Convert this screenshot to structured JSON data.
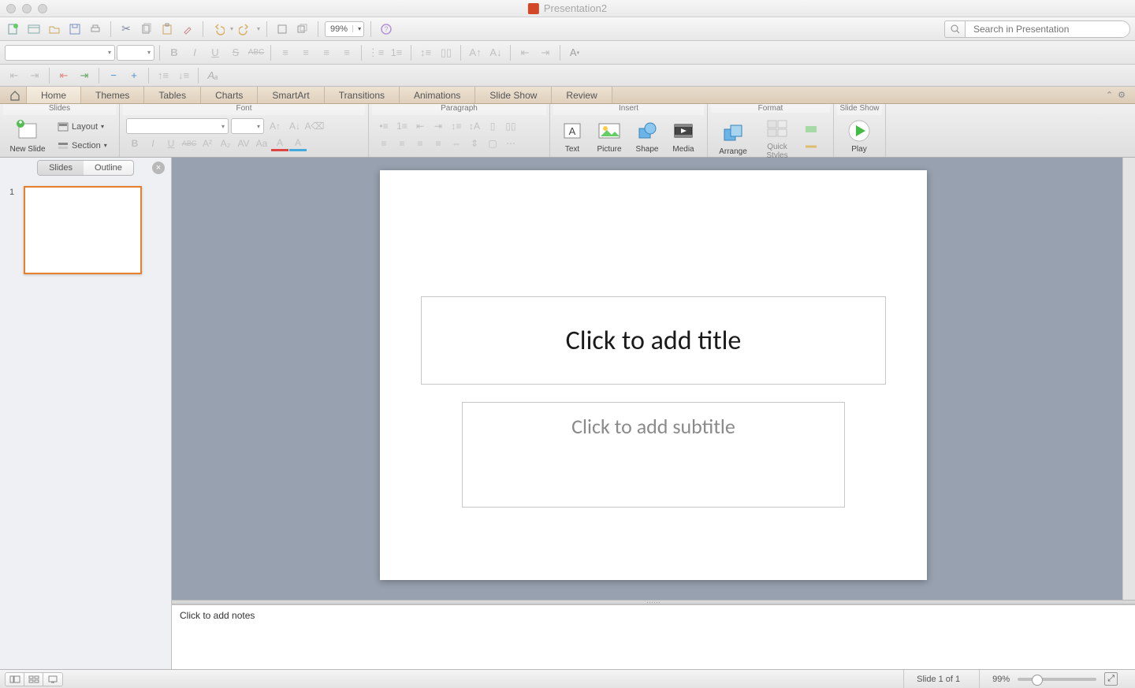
{
  "window": {
    "title": "Presentation2"
  },
  "toolbar": {
    "zoom": "99%",
    "search_placeholder": "Search in Presentation"
  },
  "tabs": {
    "items": [
      "Home",
      "Themes",
      "Tables",
      "Charts",
      "SmartArt",
      "Transitions",
      "Animations",
      "Slide Show",
      "Review"
    ],
    "active": "Home"
  },
  "ribbon": {
    "groups": {
      "slides": {
        "title": "Slides",
        "new_slide": "New Slide",
        "layout": "Layout",
        "section": "Section"
      },
      "font": {
        "title": "Font"
      },
      "paragraph": {
        "title": "Paragraph"
      },
      "insert": {
        "title": "Insert",
        "text": "Text",
        "picture": "Picture",
        "shape": "Shape",
        "media": "Media"
      },
      "format": {
        "title": "Format",
        "arrange": "Arrange",
        "quick_styles": "Quick Styles"
      },
      "slide_show": {
        "title": "Slide Show",
        "play": "Play"
      }
    }
  },
  "side_panel": {
    "tabs": {
      "slides": "Slides",
      "outline": "Outline"
    },
    "slide_number": "1"
  },
  "slide": {
    "title_placeholder": "Click to add title",
    "subtitle_placeholder": "Click to add subtitle"
  },
  "notes": {
    "placeholder": "Click to add notes"
  },
  "status": {
    "slide_info": "Slide 1 of 1",
    "zoom": "99%"
  }
}
